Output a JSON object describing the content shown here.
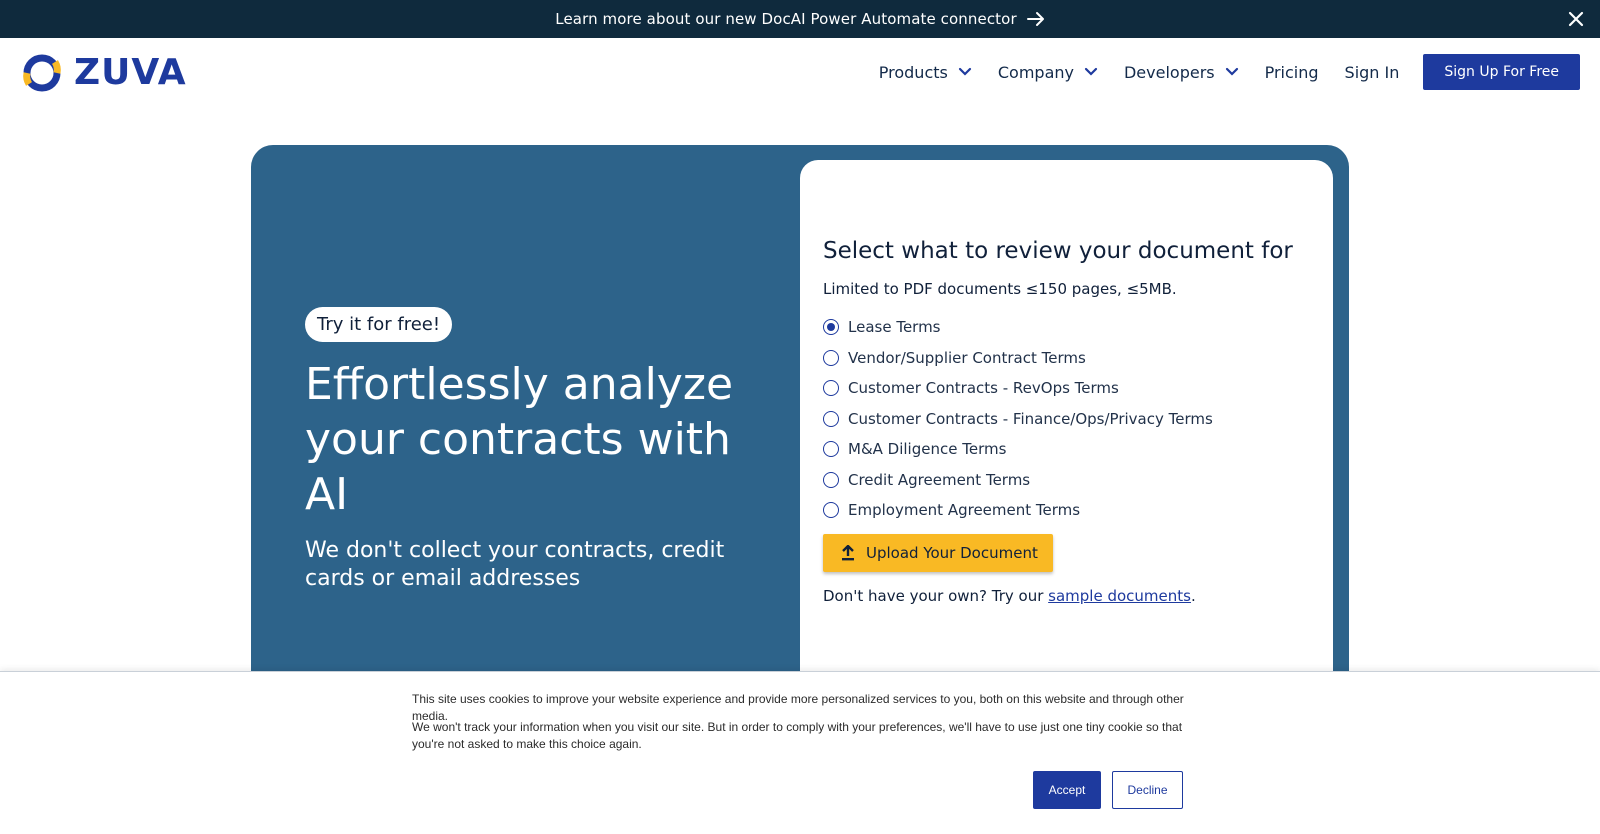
{
  "banner": {
    "text": "Learn more about our new DocAI Power Automate connector",
    "arrow_icon": "arrow-right-icon",
    "close_icon": "close-icon"
  },
  "nav": {
    "logo_text": "ZUVA",
    "items": [
      {
        "label": "Products",
        "dropdown": true
      },
      {
        "label": "Company",
        "dropdown": true
      },
      {
        "label": "Developers",
        "dropdown": true
      },
      {
        "label": "Pricing",
        "dropdown": false
      },
      {
        "label": "Sign In",
        "dropdown": false
      }
    ],
    "signup_label": "Sign Up For Free"
  },
  "hero": {
    "pill": "Try it for free!",
    "headline": "Effortlessly analyze your contracts with AI",
    "subhead": "We don't collect your contracts, credit cards or email addresses",
    "background_color": "#2d638a"
  },
  "card": {
    "title": "Select what to review your document for",
    "limit": "Limited to PDF documents ≤150 pages, ≤5MB.",
    "options": [
      {
        "label": "Lease Terms",
        "selected": true
      },
      {
        "label": "Vendor/Supplier Contract Terms",
        "selected": false
      },
      {
        "label": "Customer Contracts - RevOps Terms",
        "selected": false
      },
      {
        "label": "Customer Contracts - Finance/Ops/Privacy Terms",
        "selected": false
      },
      {
        "label": "M&A Diligence Terms",
        "selected": false
      },
      {
        "label": "Credit Agreement Terms",
        "selected": false
      },
      {
        "label": "Employment Agreement Terms",
        "selected": false
      }
    ],
    "upload_label": "Upload Your Document",
    "sample_prefix": "Don't have your own? Try our ",
    "sample_link": "sample documents",
    "sample_suffix": "."
  },
  "cookie": {
    "line1": "This site uses cookies to improve your website experience and provide more personalized services to you, both on this website and through other media.",
    "line2": "We won't track your information when you visit our site. But in order to comply with your preferences, we'll have to use just one tiny cookie so that you're not asked to make this choice again.",
    "accept_label": "Accept",
    "decline_label": "Decline"
  },
  "colors": {
    "brand": "#1e3a9e",
    "banner": "#0f2a3d",
    "accent_yellow": "#f9b924"
  }
}
